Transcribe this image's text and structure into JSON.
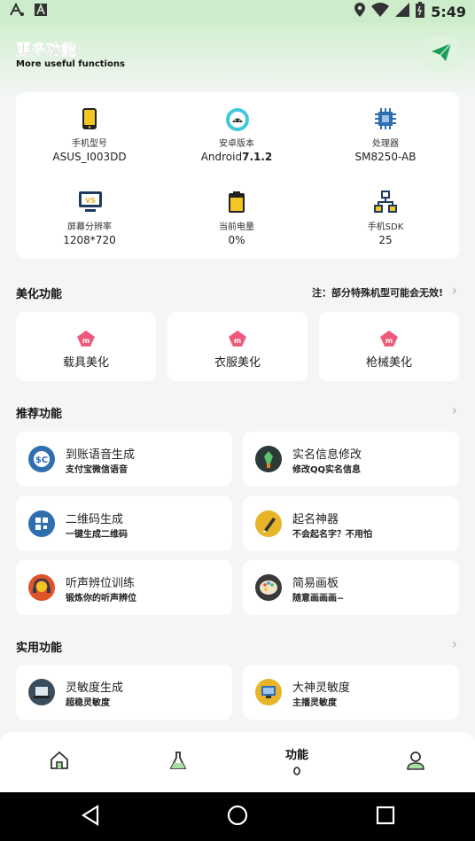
{
  "status": {
    "time": "5:49",
    "left_icons": [
      "a-icon",
      "a-box-icon"
    ],
    "right_icons": [
      "location-icon",
      "wifi-icon",
      "signal-icon",
      "battery-icon"
    ]
  },
  "header": {
    "title": "更多功能",
    "subtitle": "More useful functions"
  },
  "device_info": [
    {
      "icon": "phone-icon",
      "label": "手机型号",
      "value": "ASUS_I003DD"
    },
    {
      "icon": "android-icon",
      "label": "安卓版本",
      "value": "Android",
      "value_bold": "7.1.2"
    },
    {
      "icon": "cpu-icon",
      "label": "处理器",
      "value": "SM8250-AB"
    },
    {
      "icon": "screen-icon",
      "label": "屏幕分辨率",
      "value": "1208*720"
    },
    {
      "icon": "battery-level-icon",
      "label": "当前电量",
      "value": "0%"
    },
    {
      "icon": "network-icon",
      "label": "手机SDK",
      "value": "25"
    }
  ],
  "beautify": {
    "title": "美化功能",
    "note": "注：部分特殊机型可能会无效!",
    "items": [
      {
        "label": "载具美化"
      },
      {
        "label": "衣服美化"
      },
      {
        "label": "枪械美化"
      }
    ]
  },
  "recommend": {
    "title": "推荐功能",
    "items": [
      {
        "title": "到账语音生成",
        "sub": "支付宝微信语音",
        "icon": "money-voice-icon",
        "color": "#2f6fb0"
      },
      {
        "title": "实名信息修改",
        "sub": "修改QQ实名信息",
        "icon": "id-edit-icon",
        "color": "#2b3a38"
      },
      {
        "title": "二维码生成",
        "sub": "一键生成二维码",
        "icon": "qrcode-icon",
        "color": "#2f6fb0"
      },
      {
        "title": "起名神器",
        "sub": "不会起名字？不用怕",
        "icon": "name-pen-icon",
        "color": "#e7b42a"
      },
      {
        "title": "听声辨位训练",
        "sub": "锻炼你的听声辨位",
        "icon": "headphone-icon",
        "color": "#e0522a"
      },
      {
        "title": "简易画板",
        "sub": "随意画画画~",
        "icon": "palette-icon",
        "color": "#3a3a3a"
      }
    ]
  },
  "utility": {
    "title": "实用功能",
    "items": [
      {
        "title": "灵敏度生成",
        "sub": "超稳灵敏度",
        "icon": "laptop-icon",
        "color": "#3a4d5c"
      },
      {
        "title": "大神灵敏度",
        "sub": "主播灵敏度",
        "icon": "monitor-icon",
        "color": "#e7b42a"
      }
    ]
  },
  "nav": {
    "items": [
      "home-icon",
      "flask-icon",
      "功能",
      "user-icon"
    ],
    "active_label": "功能"
  },
  "colors": {
    "accent": "#1a9e5a",
    "header_bg": "#d2efd0",
    "page_bg": "#f4f6f5"
  }
}
